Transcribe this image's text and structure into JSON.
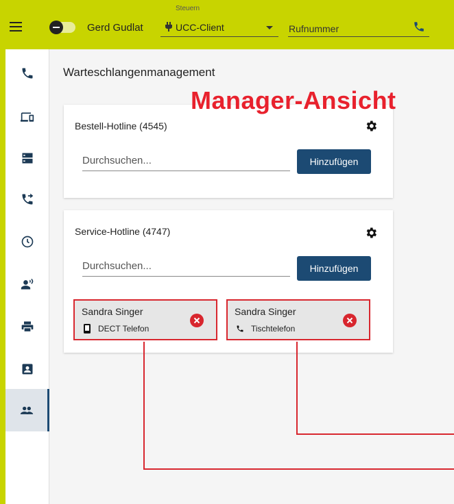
{
  "header": {
    "user_name": "Gerd Gudlat",
    "control_label": "Steuern",
    "client_value": "UCC-Client",
    "phone_placeholder": "Rufnummer"
  },
  "sidebar": {
    "items": [
      {
        "icon": "phone-icon"
      },
      {
        "icon": "devices-icon"
      },
      {
        "icon": "dns-icon"
      },
      {
        "icon": "phone-forward-icon"
      },
      {
        "icon": "history-icon"
      },
      {
        "icon": "record-voice-icon"
      },
      {
        "icon": "print-icon"
      },
      {
        "icon": "contact-card-icon"
      },
      {
        "icon": "people-icon",
        "active": true
      }
    ]
  },
  "main": {
    "title": "Warteschlangenmanagement",
    "overlay_title": "Manager-Ansicht",
    "queues": [
      {
        "title": "Bestell-Hotline (4545)",
        "search_placeholder": "Durchsuchen...",
        "add_label": "Hinzufügen",
        "agents": []
      },
      {
        "title": "Service-Hotline (4747)",
        "search_placeholder": "Durchsuchen...",
        "add_label": "Hinzufügen",
        "agents": [
          {
            "name": "Sandra Singer",
            "device": "DECT Telefon",
            "device_icon": "mobile-phone-icon"
          },
          {
            "name": "Sandra Singer",
            "device": "Tischtelefon",
            "device_icon": "desk-phone-icon"
          }
        ]
      }
    ]
  },
  "colors": {
    "topbar": "#c8d400",
    "primary_button": "#1c4a73",
    "highlight": "#e8212d",
    "remove": "#d8262e"
  }
}
